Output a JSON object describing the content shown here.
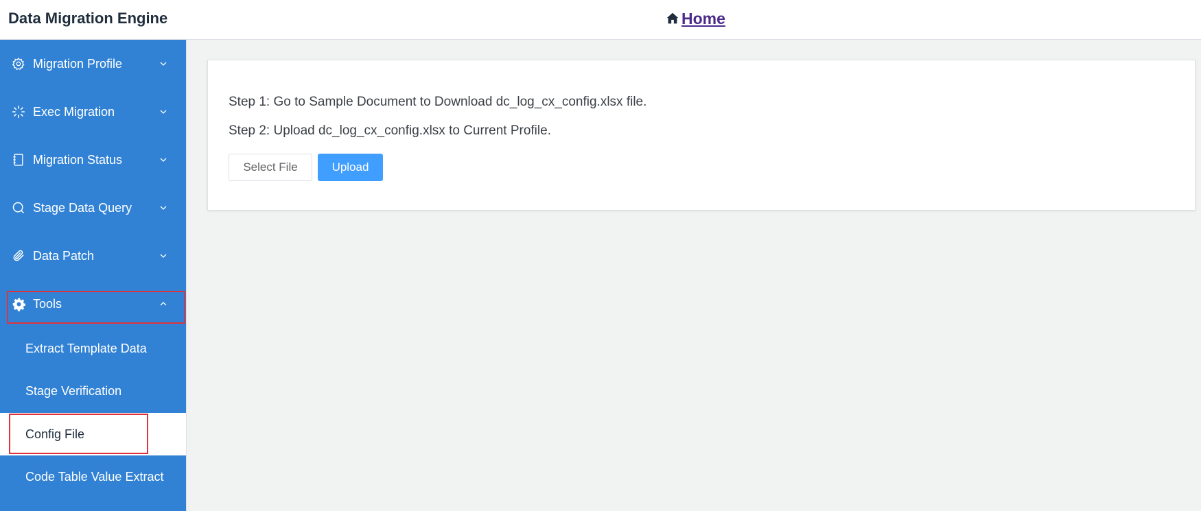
{
  "header": {
    "app_title": "Data Migration Engine",
    "home_label": "Home"
  },
  "sidebar": {
    "items": [
      {
        "label": "Migration Profile",
        "icon": "gear-outline-icon",
        "expanded": false
      },
      {
        "label": "Exec Migration",
        "icon": "loading-spinner-icon",
        "expanded": false
      },
      {
        "label": "Migration Status",
        "icon": "notebook-icon",
        "expanded": false
      },
      {
        "label": "Stage Data Query",
        "icon": "search-icon",
        "expanded": false
      },
      {
        "label": "Data Patch",
        "icon": "paperclip-icon",
        "expanded": false
      },
      {
        "label": "Tools",
        "icon": "gear-filled-icon",
        "expanded": true
      }
    ],
    "tools_submenu": [
      {
        "label": "Extract Template Data",
        "active": false
      },
      {
        "label": "Stage Verification",
        "active": false
      },
      {
        "label": "Config File",
        "active": true
      },
      {
        "label": "Code Table Value Extract",
        "active": false
      }
    ]
  },
  "main": {
    "step1": "Step 1: Go to Sample Document to Download dc_log_cx_config.xlsx file.",
    "step2": "Step 2: Upload dc_log_cx_config.xlsx to Current Profile.",
    "select_file_label": "Select File",
    "upload_label": "Upload"
  },
  "colors": {
    "sidebar_bg": "#3182d4",
    "primary_button": "#409eff",
    "highlight_box": "#e0323a",
    "main_bg": "#f1f3f2"
  }
}
